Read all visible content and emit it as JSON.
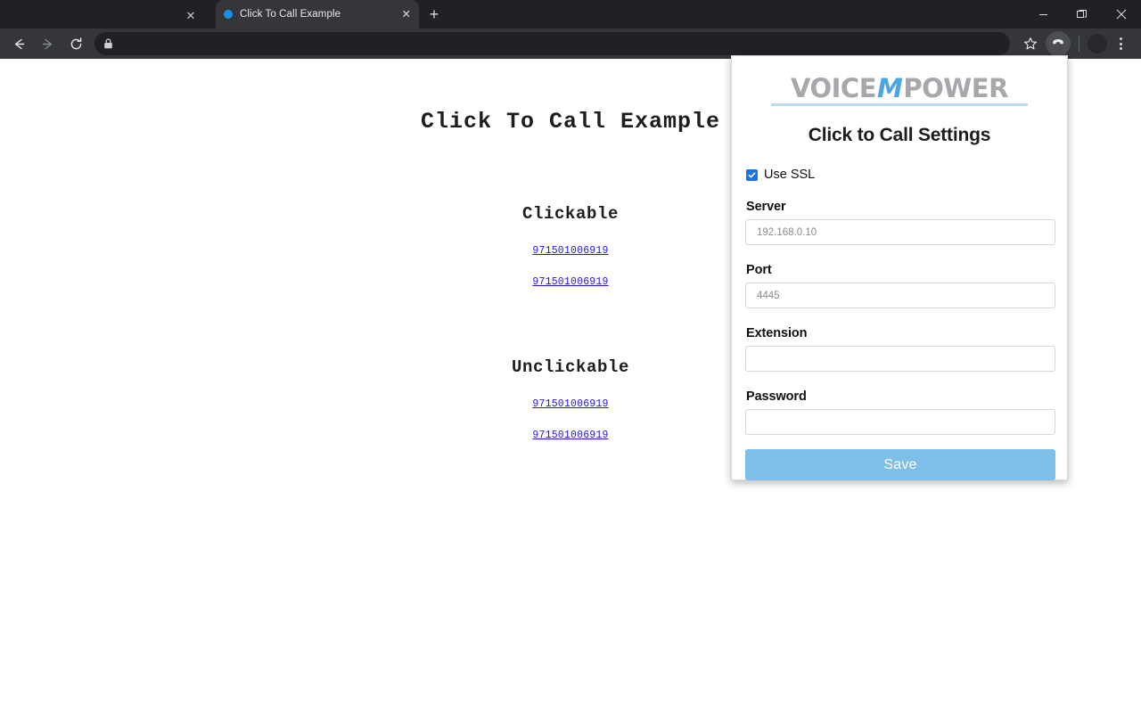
{
  "browser": {
    "tabs": [
      {
        "title": "",
        "favicon": "none",
        "partial": true,
        "close_icon": "close-icon"
      },
      {
        "title": "Click To Call Example",
        "favicon": "blue-dot-favicon",
        "partial": false,
        "close_icon": "close-icon"
      }
    ],
    "new_tab_label": "+",
    "window_controls": {
      "minimize": "minimize-icon",
      "restore": "restore-icon",
      "close": "close-icon"
    },
    "toolbar": {
      "back": "back-arrow-icon",
      "forward": "forward-arrow-icon",
      "reload": "reload-icon",
      "omnibox": {
        "lock": "lock-icon",
        "url": "",
        "placeholder": ""
      },
      "bookmark": "star-icon",
      "extension": "phone-handset-icon",
      "avatar": "avatar",
      "menu": "three-dot-menu-icon"
    }
  },
  "page": {
    "heading": "Click To Call Example",
    "sections": [
      {
        "heading": "Clickable",
        "links": [
          "971501006919",
          "971501006919"
        ]
      },
      {
        "heading": "Unclickable",
        "links": [
          "971501006919",
          "971501006919"
        ]
      }
    ]
  },
  "popup": {
    "logo": {
      "part1": "VOICE",
      "part2": "M",
      "part3": "POWER",
      "color_gray": "#a6a8ab",
      "color_blue": "#49a6e0",
      "bar_color": "#b9d9ef"
    },
    "title": "Click to Call Settings",
    "ssl": {
      "label": "Use SSL",
      "checked": true,
      "check_color": "#1a73e8"
    },
    "fields": [
      {
        "label": "Server",
        "value": "",
        "placeholder": "192.168.0.10"
      },
      {
        "label": "Port",
        "value": "",
        "placeholder": "4445"
      },
      {
        "label": "Extension",
        "value": "",
        "placeholder": ""
      },
      {
        "label": "Password",
        "value": "",
        "placeholder": ""
      }
    ],
    "save_button": {
      "label": "Save",
      "color": "#7dbfe8"
    }
  }
}
